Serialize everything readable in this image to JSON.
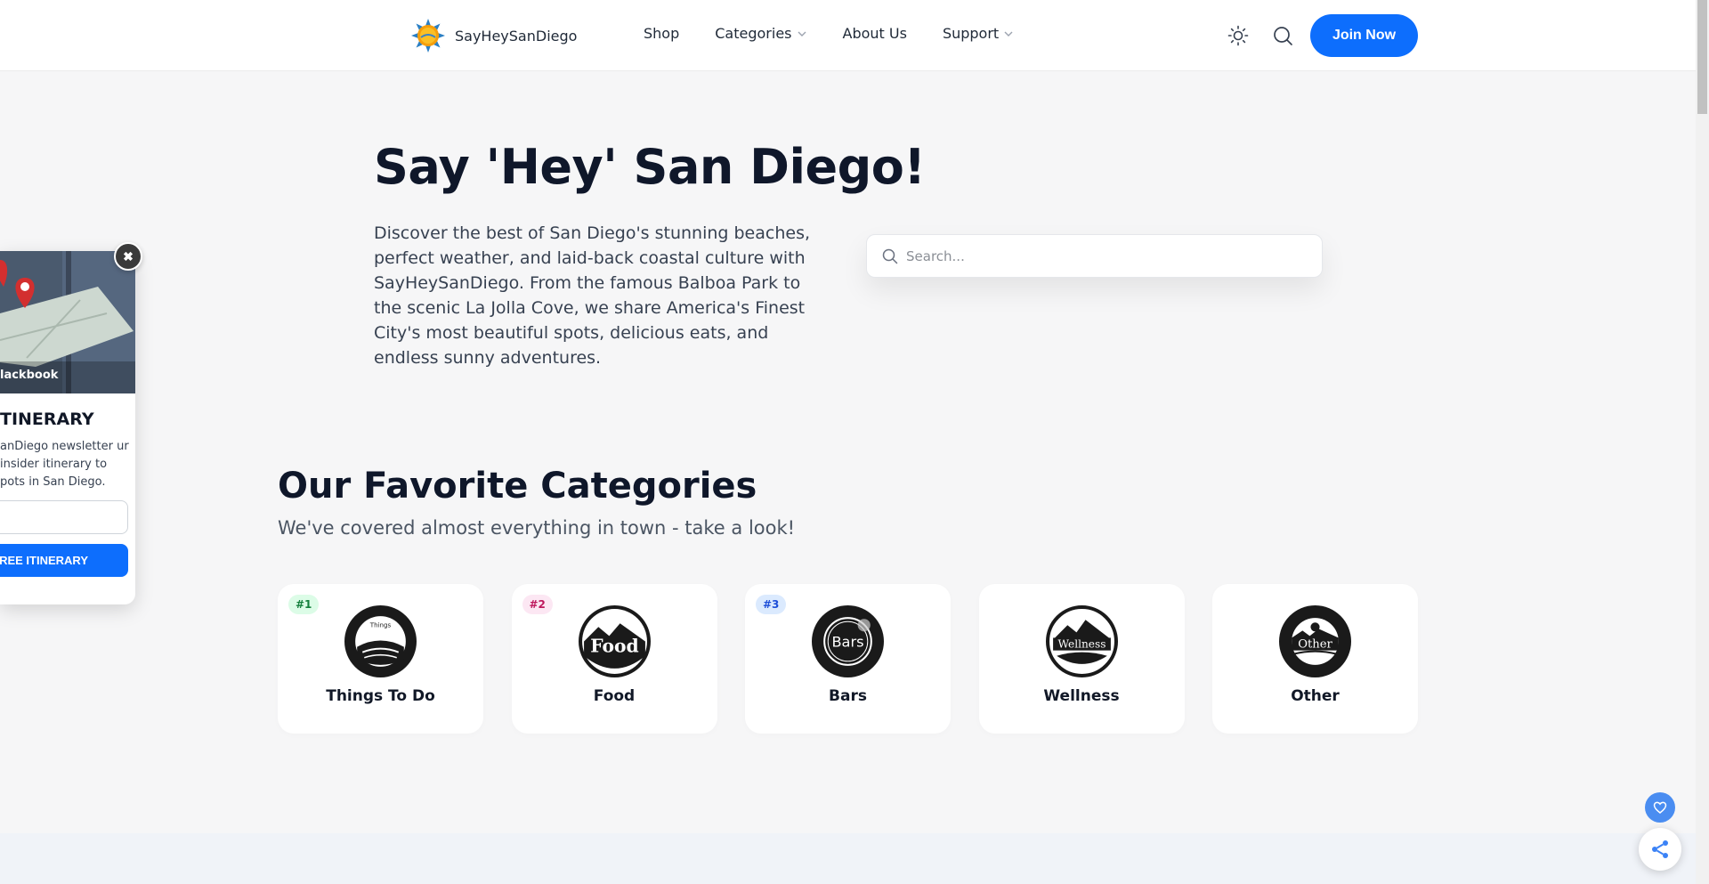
{
  "header": {
    "logo_text": "SayHeySanDiego",
    "nav": [
      {
        "label": "Shop",
        "has_dropdown": false
      },
      {
        "label": "Categories",
        "has_dropdown": true
      },
      {
        "label": "About Us",
        "has_dropdown": false
      },
      {
        "label": "Support",
        "has_dropdown": true
      }
    ],
    "join_label": "Join Now"
  },
  "hero": {
    "title": "Say 'Hey' San Diego!",
    "description": "Discover the best of San Diego's stunning beaches, perfect weather, and laid-back coastal culture with SayHeySanDiego. From the famous Balboa Park to the scenic La Jolla Cove, we share America's Finest City's most beautiful spots, delicious eats, and endless sunny adventures.",
    "search_placeholder": "Search..."
  },
  "categories": {
    "title": "Our Favorite Categories",
    "subtitle": "We've covered almost everything in town - take a look!",
    "items": [
      {
        "rank": "#1",
        "label": "Things To Do",
        "icon": "things-to-do-icon",
        "icon_text": "Things"
      },
      {
        "rank": "#2",
        "label": "Food",
        "icon": "food-icon",
        "icon_text": "Food"
      },
      {
        "rank": "#3",
        "label": "Bars",
        "icon": "bars-icon",
        "icon_text": "Bars"
      },
      {
        "rank": "",
        "label": "Wellness",
        "icon": "wellness-icon",
        "icon_text": "Wellness"
      },
      {
        "rank": "",
        "label": "Other",
        "icon": "other-icon",
        "icon_text": "Other"
      }
    ]
  },
  "popup": {
    "image_label": "lackbook",
    "heading": "TINERARY",
    "text": "anDiego newsletter ur insider itinerary to pots in San Diego.",
    "button_label": "FREE ITINERARY",
    "close_label": "✖"
  },
  "colors": {
    "accent": "#0d6efd",
    "rank1_bg": "#dcfce7",
    "rank1_fg": "#15803d",
    "rank2_bg": "#fce7f3",
    "rank2_fg": "#be185d",
    "rank3_bg": "#dbeafe",
    "rank3_fg": "#1d4ed8"
  }
}
